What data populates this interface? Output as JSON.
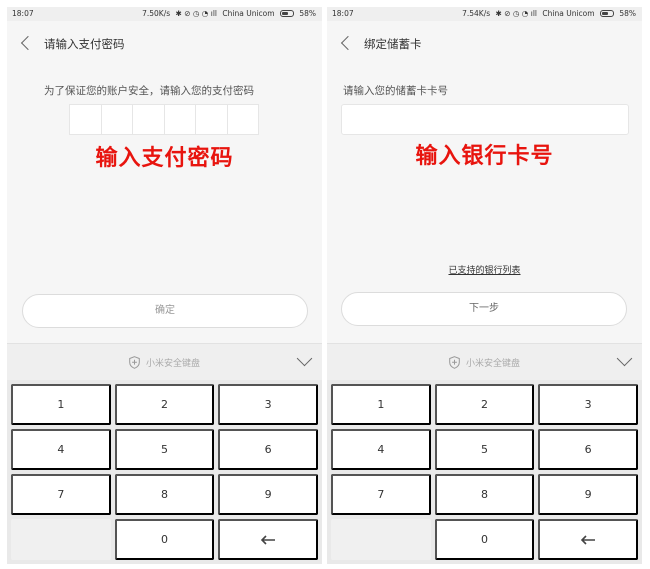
{
  "left_screen": {
    "status_bar": {
      "time": "18:07",
      "speed": "7.50K/s",
      "carrier": "China Unicom",
      "battery": "58%"
    },
    "title": "请输入支付密码",
    "prompt": "为了保证您的账户安全，请输入您的支付密码",
    "pin_length": 6,
    "overlay_label": "输入支付密码",
    "confirm_button": "确定",
    "keyboard_label": "小米安全键盘"
  },
  "right_screen": {
    "status_bar": {
      "time": "18:07",
      "speed": "7.54K/s",
      "carrier": "China Unicom",
      "battery": "58%"
    },
    "title": "绑定储蓄卡",
    "prompt": "请输入您的储蓄卡卡号",
    "card_input": {
      "value": "",
      "placeholder": ""
    },
    "overlay_label": "输入银行卡号",
    "bank_list_link": "已支持的银行列表",
    "next_button": "下一步",
    "keyboard_label": "小米安全键盘"
  },
  "keypad": {
    "keys": [
      "1",
      "2",
      "3",
      "4",
      "5",
      "6",
      "7",
      "8",
      "9",
      "",
      "0"
    ],
    "backspace_icon": "backspace-arrow-icon"
  },
  "icons": {
    "back": "back-chevron-icon",
    "shield": "shield-icon",
    "collapse": "chevron-down-icon"
  },
  "colors": {
    "overlay_text": "#e8140e",
    "background": "#f6f6f6",
    "keypad_bg": "#e9e9e9"
  }
}
